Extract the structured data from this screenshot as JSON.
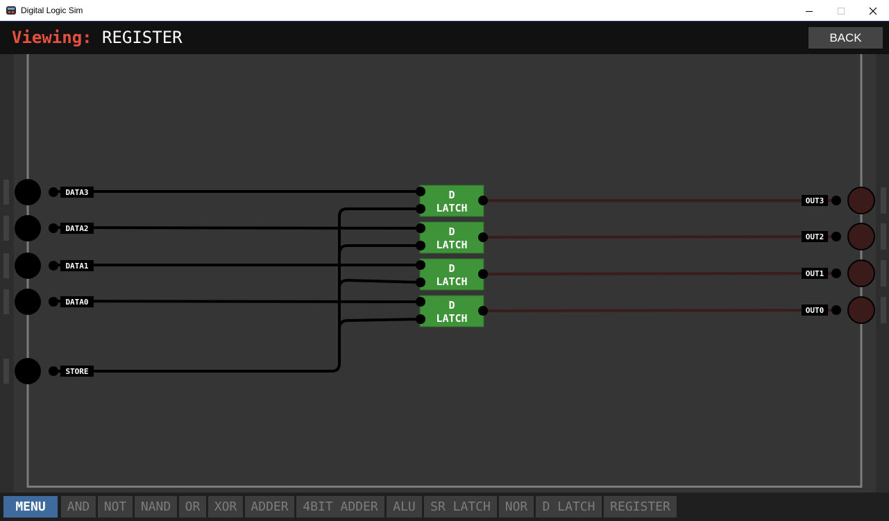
{
  "window": {
    "title": "Digital Logic Sim",
    "controls": {
      "minimize": "minimize-icon",
      "maximize": "maximize-icon",
      "close": "close-icon"
    }
  },
  "header": {
    "viewing_label": "Viewing:",
    "chip_name": "REGISTER",
    "back_label": "BACK"
  },
  "inputs": [
    {
      "label": "DATA3"
    },
    {
      "label": "DATA2"
    },
    {
      "label": "DATA1"
    },
    {
      "label": "DATA0"
    },
    {
      "label": "STORE"
    }
  ],
  "chips": [
    {
      "line1": "D",
      "line2": "LATCH"
    },
    {
      "line1": "D",
      "line2": "LATCH"
    },
    {
      "line1": "D",
      "line2": "LATCH"
    },
    {
      "line1": "D",
      "line2": "LATCH"
    }
  ],
  "outputs": [
    {
      "label": "OUT3"
    },
    {
      "label": "OUT2"
    },
    {
      "label": "OUT1"
    },
    {
      "label": "OUT0"
    }
  ],
  "taskbar": {
    "menu_label": "MENU",
    "items": [
      "AND",
      "NOT",
      "NAND",
      "OR",
      "XOR",
      "ADDER",
      "4BIT ADDER",
      "ALU",
      "SR LATCH",
      "NOR",
      "D LATCH",
      "REGISTER"
    ]
  },
  "colors": {
    "accent_viewing": "#e7503f",
    "chip_fill": "#3f943a",
    "wire_off": "#000000",
    "output_wire_off": "#3a1c1c",
    "output_pin_off": "#3b1a1a",
    "menu_button": "#3e6a9e"
  }
}
